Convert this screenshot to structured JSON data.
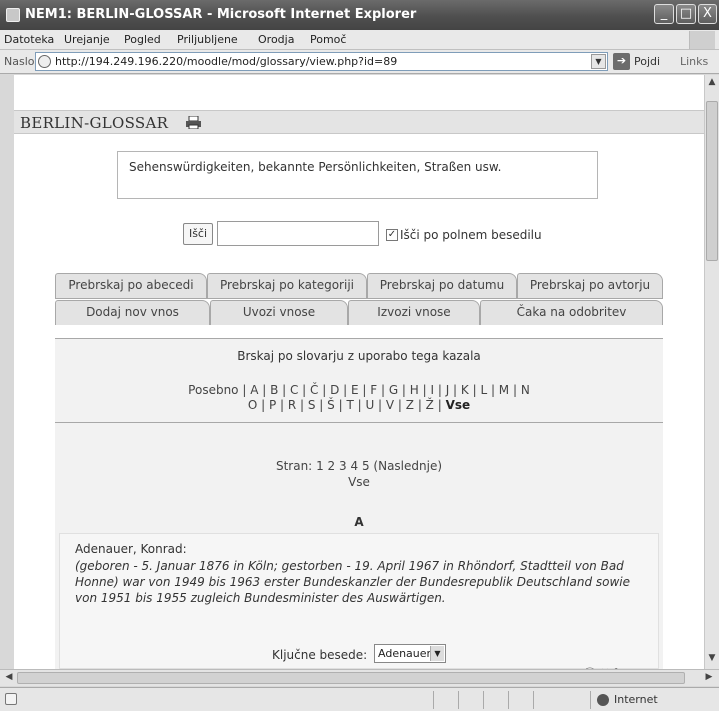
{
  "window": {
    "title": "NEM1: BERLIN-GLOSSAR - Microsoft Internet Explorer",
    "controls": {
      "minimize": "_",
      "maximize": "□",
      "close": "X"
    }
  },
  "menu": [
    "Datoteka",
    "Urejanje",
    "Pogled",
    "Priljubljene",
    "Orodja",
    "Pomoč"
  ],
  "address": {
    "label": "Naslov",
    "url": "http://194.249.196.220/moodle/mod/glossary/view.php?id=89",
    "go_label": "Pojdi",
    "links_label": "Links"
  },
  "page": {
    "title": "BERLIN-GLOSSAR",
    "intro": "Sehenswürdigkeiten, bekannte Persönlichkeiten, Straßen usw.",
    "search": {
      "button": "Išči",
      "value": "",
      "fulltext_label": "Išči po polnem besedilu",
      "fulltext_checked": true
    },
    "tabs_row1": [
      "Prebrskaj po abecedi",
      "Prebrskaj po kategoriji",
      "Prebrskaj po datumu",
      "Prebrskaj po avtorju"
    ],
    "tabs_row2": [
      "Dodaj nov vnos",
      "Uvozi vnose",
      "Izvozi vnose",
      "Čaka na odobritev"
    ],
    "browse_desc": "Brskaj po slovarju z uporabo tega kazala",
    "alpha_line1": "Posebno | A | B | C | Č | D | E | F | G | H | I | J | K | L | M | N",
    "alpha_line2_prefix": "O | P | R | S | Š | T | U | V | Z | Ž |",
    "alpha_all": "Vse",
    "pager": {
      "label": "Stran:",
      "pages": [
        "1",
        "2",
        "3",
        "4",
        "5"
      ],
      "next": "(Naslednje)",
      "all": "Vse"
    },
    "letter": "A",
    "entry": {
      "term": "Adenauer, Konrad:",
      "definition": "(geboren  - 5. Januar 1876 in Köln; gestorben -  19. April 1967 in Rhöndorf, Stadtteil von Bad Honne) war von 1949 bis 1963 erster Bundeskanzler der Bundesrepublik Deutschland sowie von 1951 bis 1955 zugleich Bundesminister des Auswärtigen.",
      "keywords_label": "Ključne besede:",
      "keyword_selected": "Adenauer"
    }
  },
  "status": {
    "zone": "Internet"
  }
}
